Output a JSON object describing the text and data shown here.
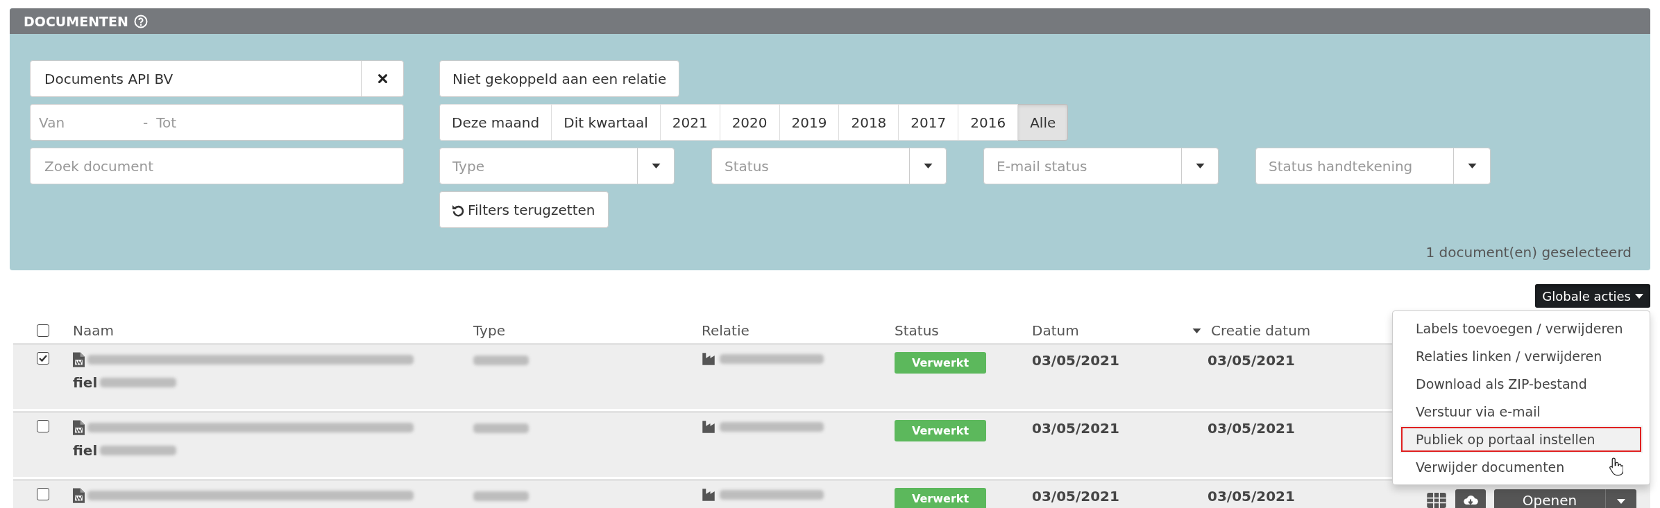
{
  "panel": {
    "title": "DOCUMENTEN",
    "relation_filter": {
      "value": "Documents API BV"
    },
    "date_range": {
      "from_placeholder": "Van",
      "separator": "-",
      "to_placeholder": "Tot"
    },
    "search": {
      "placeholder": "Zoek document"
    },
    "unlinked_button": "Niet gekoppeld aan een relatie",
    "periods": [
      {
        "label": "Deze maand",
        "selected": false
      },
      {
        "label": "Dit kwartaal",
        "selected": false
      },
      {
        "label": "2021",
        "selected": false
      },
      {
        "label": "2020",
        "selected": false
      },
      {
        "label": "2019",
        "selected": false
      },
      {
        "label": "2018",
        "selected": false
      },
      {
        "label": "2017",
        "selected": false
      },
      {
        "label": "2016",
        "selected": false
      },
      {
        "label": "Alle",
        "selected": true
      }
    ],
    "dropdowns": [
      {
        "placeholder": "Type"
      },
      {
        "placeholder": "Status"
      },
      {
        "placeholder": "E-mail status"
      },
      {
        "placeholder": "Status handtekening"
      }
    ],
    "reset_button": "Filters terugzetten",
    "selection_count": "1 document(en) geselecteerd"
  },
  "global_actions": {
    "label": "Globale acties",
    "expanded": true,
    "items": [
      {
        "label": "Labels toevoegen / verwijderen",
        "selected": false
      },
      {
        "label": "Relaties linken / verwijderen",
        "selected": false
      },
      {
        "label": "Download als ZIP-bestand",
        "selected": false
      },
      {
        "label": "Verstuur via e-mail",
        "selected": false
      },
      {
        "label": "Publiek op portaal instellen",
        "selected": true
      },
      {
        "label": "Verwijder documenten",
        "selected": false
      }
    ]
  },
  "table": {
    "header_checked": false,
    "columns": [
      {
        "label": "Naam",
        "sorted": false
      },
      {
        "label": "Type",
        "sorted": false
      },
      {
        "label": "Relatie",
        "sorted": false
      },
      {
        "label": "Status",
        "sorted": false
      },
      {
        "label": "Datum",
        "sorted": false
      },
      {
        "label": "Creatie datum",
        "sorted": true
      }
    ],
    "rows": [
      {
        "checked": true,
        "name": "fiel",
        "status": "Verwerkt",
        "datum": "03/05/2021",
        "creatie_datum": "03/05/2021"
      },
      {
        "checked": false,
        "name": "fiel",
        "status": "Verwerkt",
        "datum": "03/05/2021",
        "creatie_datum": "03/05/2021"
      },
      {
        "checked": false,
        "status": "Verwerkt",
        "datum": "03/05/2021",
        "creatie_datum": "03/05/2021",
        "open_button": "Openen"
      }
    ]
  }
}
